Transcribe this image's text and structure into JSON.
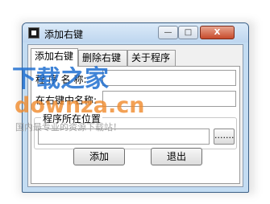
{
  "window": {
    "title": "添加右键",
    "minimize_glyph": "—",
    "maximize_glyph": "□",
    "close_glyph": "X"
  },
  "tabs": [
    "添加右键",
    "删除右键",
    "关于程序"
  ],
  "form": {
    "program_name_label": "程 序 名 称:",
    "program_name_value": "",
    "menu_name_label": "在右键中名称:",
    "menu_name_value": "",
    "location_group_label": "程序所在位置",
    "location_value": "",
    "browse_label": "......."
  },
  "buttons": {
    "add_label": "添加",
    "exit_label": "退出"
  },
  "watermark": {
    "line1": "下载之家",
    "line2": "downza.cn",
    "line3": "国内最专业的资源下载站！"
  }
}
